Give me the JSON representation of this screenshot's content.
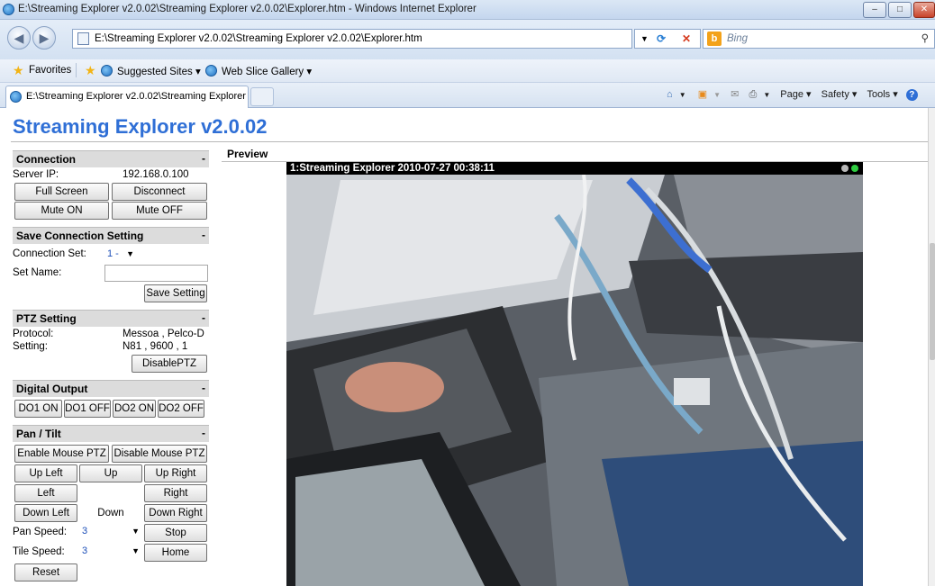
{
  "window": {
    "title": "E:\\Streaming Explorer v2.0.02\\Streaming Explorer v2.0.02\\Explorer.htm - Windows Internet Explorer",
    "minimize": "–",
    "maximize": "□",
    "close": "✕"
  },
  "address": {
    "back": "◀",
    "forward": "▶",
    "url": "E:\\Streaming Explorer v2.0.02\\Streaming Explorer v2.0.02\\Explorer.htm",
    "search_placeholder": "Bing",
    "search_logo": "b"
  },
  "favorites": {
    "label": "Favorites",
    "suggested": "Suggested Sites ▾",
    "webslice": "Web Slice Gallery ▾"
  },
  "tab": {
    "label": "E:\\Streaming Explorer v2.0.02\\Streaming Explorer ..."
  },
  "commandbar": {
    "page": "Page ▾",
    "safety": "Safety ▾",
    "tools": "Tools ▾",
    "help": "?"
  },
  "app": {
    "title": "Streaming Explorer v2.0.02",
    "preview_header": "Preview",
    "video_caption": "1:Streaming Explorer  2010-07-27 00:38:11"
  },
  "connection": {
    "header": "Connection",
    "collapse": "-",
    "server_ip_label": "Server IP:",
    "server_ip_value": "192.168.0.100",
    "full_screen": "Full Screen",
    "disconnect": "Disconnect",
    "mute_on": "Mute ON",
    "mute_off": "Mute OFF"
  },
  "save_connection": {
    "header": "Save Connection Setting",
    "collapse": "-",
    "set_label": "Connection Set:",
    "set_value": "1 -",
    "name_label": "Set Name:",
    "name_value": "",
    "save_button": "Save Setting"
  },
  "ptz": {
    "header": "PTZ Setting",
    "collapse": "-",
    "protocol_label": "Protocol:",
    "protocol_value": "Messoa , Pelco-D",
    "setting_label": "Setting:",
    "setting_value": "N81 , 9600 , 1",
    "disable_button": "DisablePTZ"
  },
  "digital_output": {
    "header": "Digital Output",
    "collapse": "-",
    "do1_on": "DO1 ON",
    "do1_off": "DO1 OFF",
    "do2_on": "DO2 ON",
    "do2_off": "DO2 OFF"
  },
  "pan_tilt": {
    "header": "Pan / Tilt",
    "collapse": "-",
    "enable_mouse": "Enable Mouse PTZ",
    "disable_mouse": "Disable Mouse PTZ",
    "up_left": "Up Left",
    "up": "Up",
    "up_right": "Up Right",
    "left": "Left",
    "right": "Right",
    "down_left": "Down Left",
    "down": "Down",
    "down_right": "Down Right",
    "pan_speed_label": "Pan Speed:",
    "pan_speed_value": "3",
    "tilt_speed_label": "Tile Speed:",
    "tilt_speed_value": "3",
    "stop": "Stop",
    "home": "Home",
    "reset": "Reset"
  }
}
